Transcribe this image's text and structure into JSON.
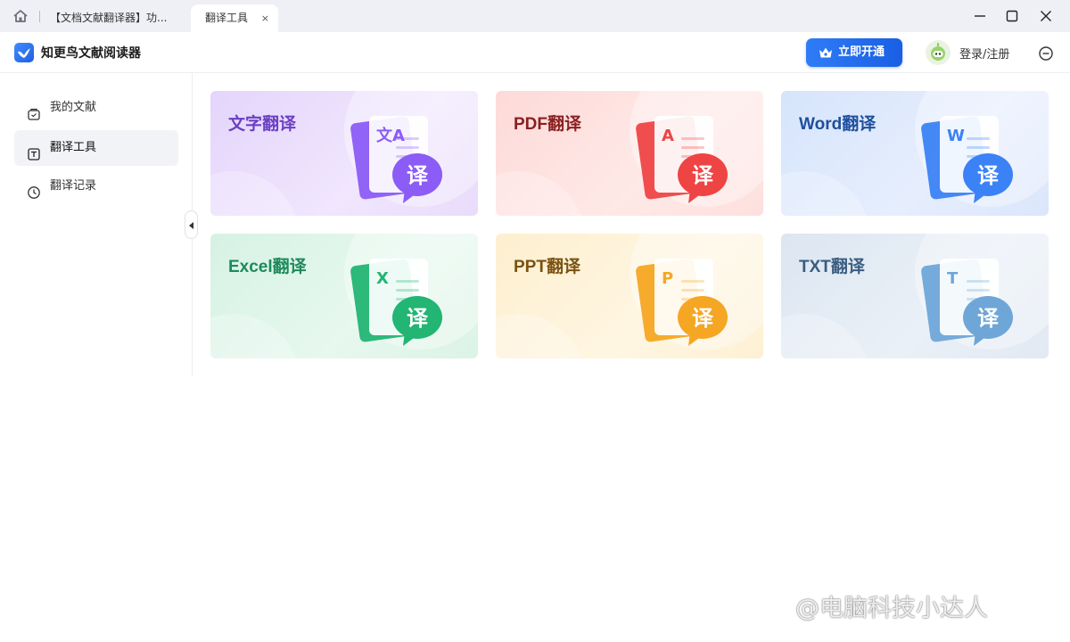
{
  "tabs": [
    {
      "label": "【文档文献翻译器】功..."
    },
    {
      "label": "翻译工具"
    }
  ],
  "tab_close_glyph": "×",
  "app": {
    "title": "知更鸟文献阅读器"
  },
  "header": {
    "vip_label": "立即开通",
    "login_label": "登录/注册"
  },
  "sidebar": {
    "items": [
      {
        "label": "我的文献",
        "icon": "document-bag-icon",
        "active": false
      },
      {
        "label": "翻译工具",
        "icon": "translate-tool-icon",
        "active": true
      },
      {
        "label": "翻译记录",
        "icon": "clock-icon",
        "active": false
      }
    ]
  },
  "cards": [
    {
      "title": "文字翻译",
      "color": "#6b3fc2",
      "accent": "#8b5cf6",
      "glyph": "文A",
      "bubble": "译"
    },
    {
      "title": "PDF翻译",
      "color": "#8a1f1f",
      "accent": "#ef4444",
      "glyph": "A",
      "bubble": "译"
    },
    {
      "title": "Word翻译",
      "color": "#1e4f9e",
      "accent": "#3b82f6",
      "glyph": "W",
      "bubble": "译"
    },
    {
      "title": "Excel翻译",
      "color": "#1c8a5a",
      "accent": "#22b573",
      "glyph": "X",
      "bubble": "译"
    },
    {
      "title": "PPT翻译",
      "color": "#7a5210",
      "accent": "#f5a623",
      "glyph": "P",
      "bubble": "译"
    },
    {
      "title": "TXT翻译",
      "color": "#3a5d80",
      "accent": "#6ea6d8",
      "glyph": "T",
      "bubble": "译"
    }
  ],
  "watermark": "@电脑科技小达人",
  "colors": {
    "primary": "#1f6bee",
    "tab_bar": "#eef0f5"
  }
}
